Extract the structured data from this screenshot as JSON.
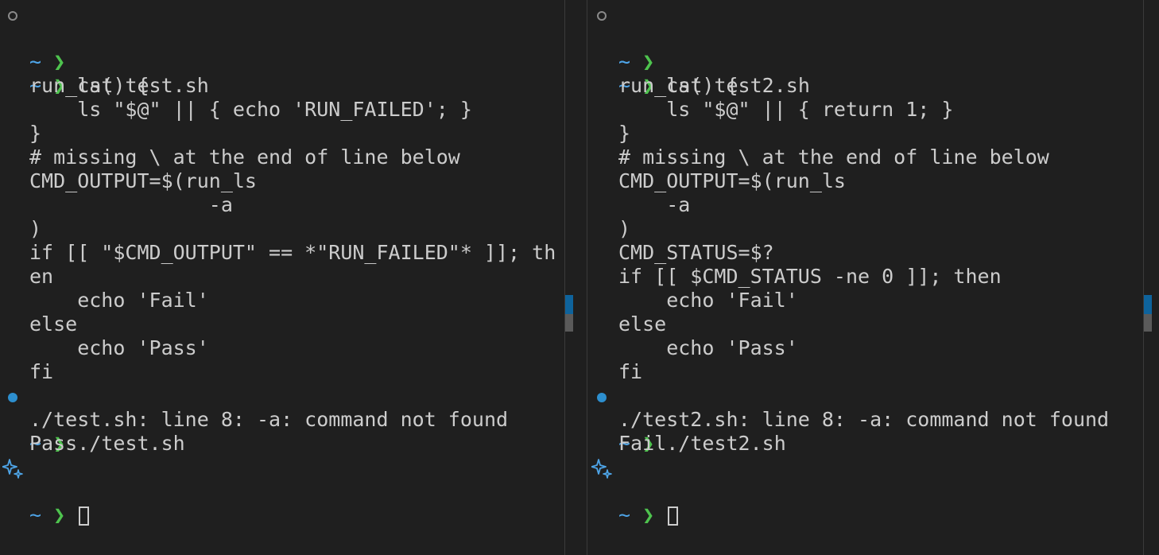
{
  "prompt": {
    "tilde": "~",
    "arrow": "❯"
  },
  "left": {
    "lines": [
      "",
      "",
      "cat test.sh",
      "run_ls() {",
      "    ls \"$@\" || { echo 'RUN_FAILED'; }",
      "}",
      "# missing \\ at the end of line below",
      "CMD_OUTPUT=$(run_ls",
      "               -a",
      ")",
      "if [[ \"$CMD_OUTPUT\" == *\"RUN_FAILED\"* ]]; th",
      "en",
      "    echo 'Fail'",
      "else",
      "    echo 'Pass'",
      "fi",
      "./test.sh",
      "./test.sh: line 8: -a: command not found",
      "Pass",
      ""
    ]
  },
  "right": {
    "lines": [
      "",
      "",
      "cat test2.sh",
      "run_ls() {",
      "    ls \"$@\" || { return 1; }",
      "}",
      "# missing \\ at the end of line below",
      "CMD_OUTPUT=$(run_ls",
      "    -a",
      ")",
      "CMD_STATUS=$?",
      "if [[ $CMD_STATUS -ne 0 ]]; then",
      "    echo 'Fail'",
      "else",
      "    echo 'Pass'",
      "fi",
      "./test2.sh",
      "./test2.sh: line 8: -a: command not found",
      "Fail",
      ""
    ]
  },
  "colors": {
    "background": "#1f1f1f",
    "text": "#cccccc",
    "prompt_tilde": "#4ea5e8",
    "prompt_arrow": "#4ec34e",
    "status_dot": "#2d8fcf",
    "scrollbar_mark": "#0e639c"
  },
  "icons": {
    "empty_status": "empty-circle-icon",
    "success_status": "filled-circle-icon",
    "active_prompt": "sparkle-icon"
  }
}
